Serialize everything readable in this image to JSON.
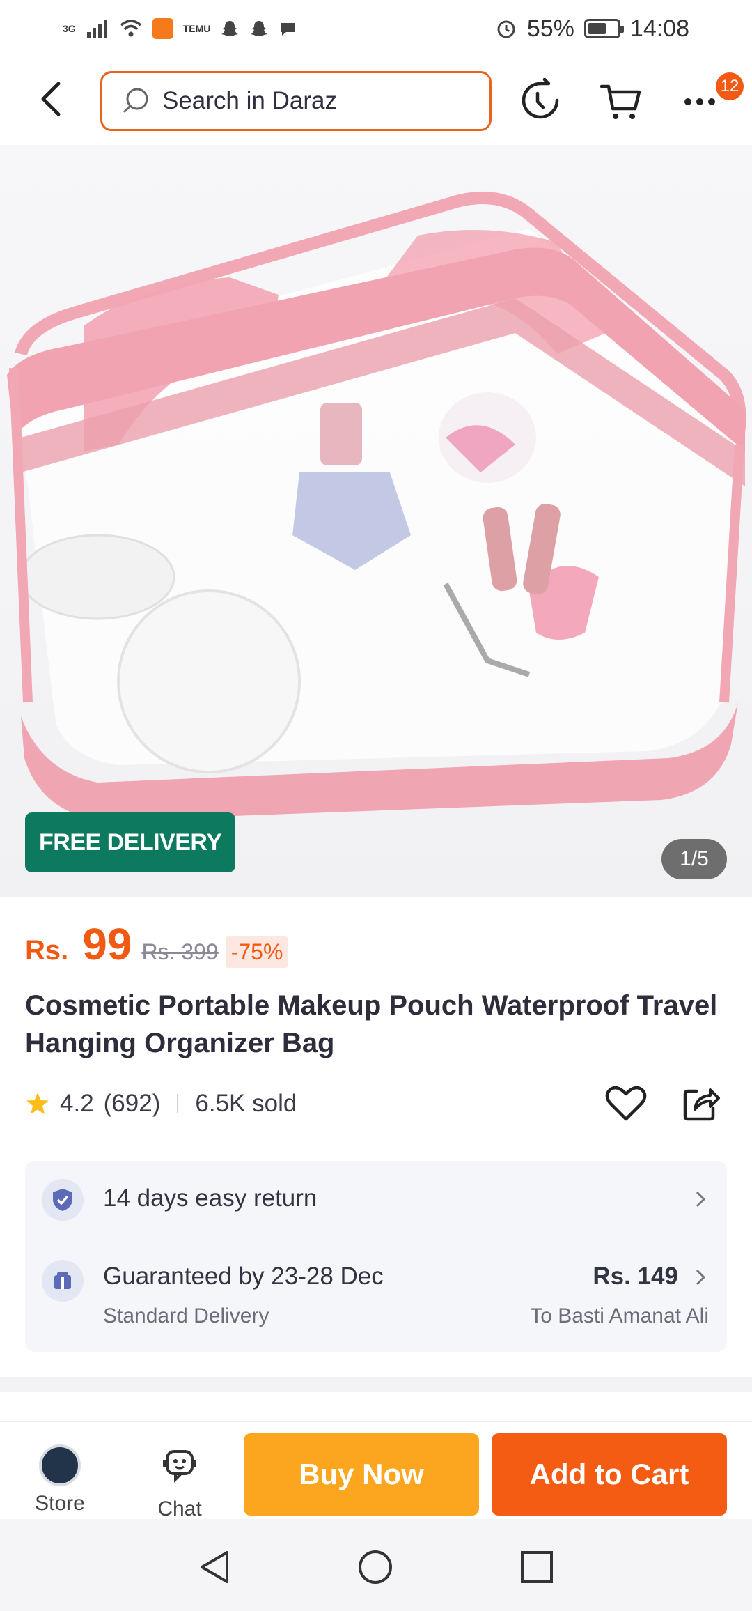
{
  "status_bar": {
    "network": "3G",
    "mini_labels": [
      "TEMU"
    ],
    "battery": "55%",
    "time": "14:08"
  },
  "header": {
    "search_placeholder": "Search in Daraz",
    "more_badge": "12"
  },
  "gallery": {
    "free_delivery_label": "FREE DELIVERY",
    "page_indicator": "1/5"
  },
  "product": {
    "currency": "Rs.",
    "price": "99",
    "original_price": "Rs. 399",
    "discount": "-75%",
    "title": "Cosmetic Portable Makeup Pouch Waterproof Travel Hanging Organizer Bag",
    "rating": "4.2",
    "rating_count": "(692)",
    "sold": "6.5K sold"
  },
  "info": {
    "return_label": "14 days easy return",
    "delivery_label": "Guaranteed by 23-28 Dec",
    "delivery_type": "Standard Delivery",
    "delivery_price": "Rs. 149",
    "delivery_to": "To Basti Amanat Ali"
  },
  "bottom_bar": {
    "store_label": "Store",
    "chat_label": "Chat",
    "buy_now_label": "Buy Now",
    "add_to_cart_label": "Add to Cart"
  },
  "colors": {
    "accent": "#f25a14",
    "buy_now": "#fba61e",
    "add_to_cart": "#f45b13",
    "free_delivery": "#0d7a5f"
  }
}
